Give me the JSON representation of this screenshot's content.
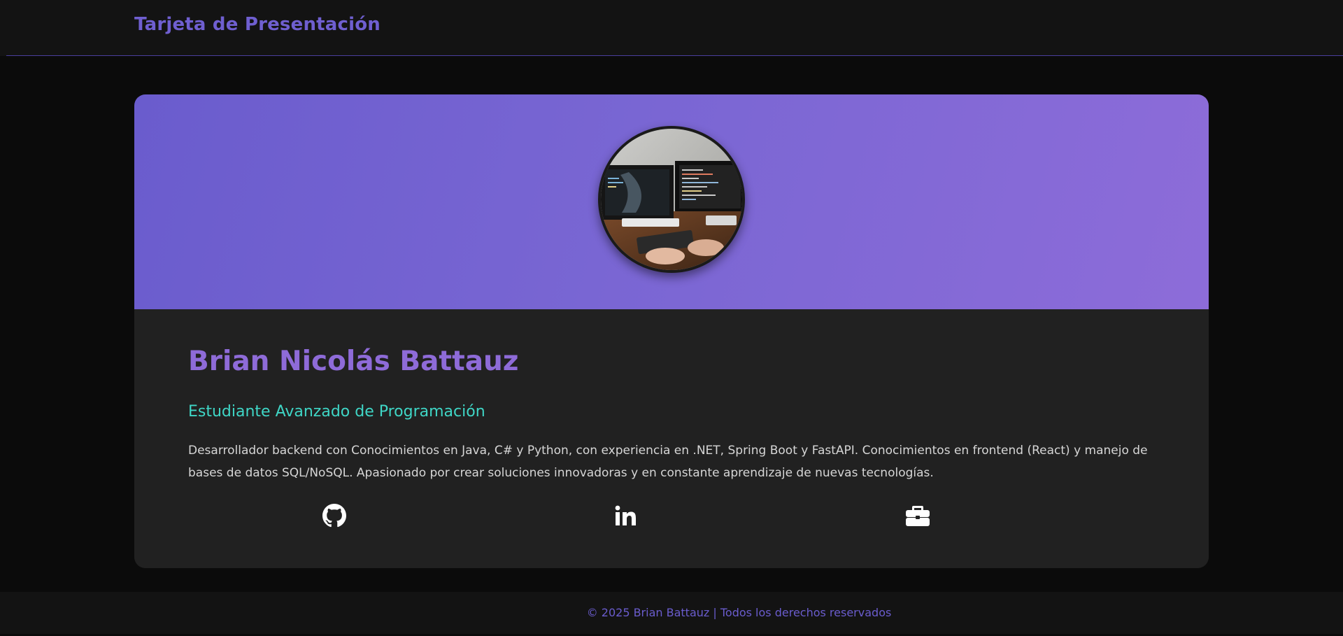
{
  "header": {
    "brand_title": "Tarjeta de Presentación"
  },
  "profile": {
    "photo_icon": "developer-workstation-photo",
    "name": "Brian Nicolás Battauz",
    "role": "Estudiante Avanzado de Programación",
    "bio": "Desarrollador backend con Conocimientos en Java, C# y Python, con experiencia en .NET, Spring Boot y FastAPI. Conocimientos en frontend (React) y manejo de bases de datos SQL/NoSQL. Apasionado por crear soluciones innovadoras y en constante aprendizaje de nuevas tecnologías."
  },
  "social_links": [
    {
      "icon": "github-icon"
    },
    {
      "icon": "linkedin-icon"
    },
    {
      "icon": "briefcase-icon"
    }
  ],
  "footer": {
    "copyright": "© 2025 Brian Battauz | Todos los derechos reservados"
  },
  "colors": {
    "accent": "#6a5ccd",
    "name": "#8e6bd8",
    "role": "#3fd6c6",
    "card_bg": "#212121",
    "page_bg": "#0b0b0b"
  }
}
